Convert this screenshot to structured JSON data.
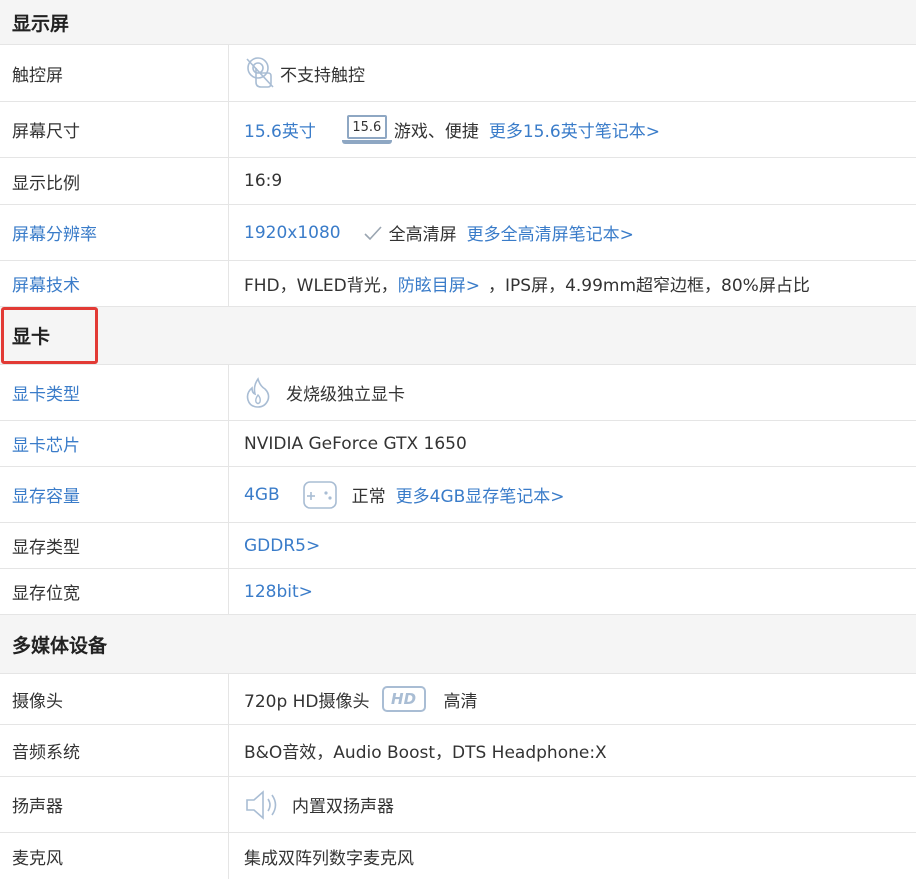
{
  "sections": {
    "display": {
      "title": "显示屏",
      "touch": {
        "label": "触控屏",
        "value": "不支持触控"
      },
      "size": {
        "label": "屏幕尺寸",
        "value": "15.6英寸",
        "badge": "15.6",
        "tag": "游戏、便捷",
        "more": "更多15.6英寸笔记本>"
      },
      "ratio": {
        "label": "显示比例",
        "value": "16:9"
      },
      "resolution": {
        "label": "屏幕分辨率",
        "value": "1920x1080",
        "tag": "全高清屏",
        "more": "更多全高清屏笔记本>"
      },
      "tech": {
        "label": "屏幕技术",
        "prefix": "FHD，WLED背光，",
        "link": "防眩目屏>",
        "suffix": "，IPS屏，4.99mm超窄边框，80%屏占比"
      }
    },
    "gpu": {
      "title": "显卡",
      "type": {
        "label": "显卡类型",
        "value": "发烧级独立显卡"
      },
      "chip": {
        "label": "显卡芯片",
        "value": "NVIDIA GeForce GTX 1650"
      },
      "memory": {
        "label": "显存容量",
        "value": "4GB",
        "tag": "正常",
        "more": "更多4GB显存笔记本>"
      },
      "memtype": {
        "label": "显存类型",
        "value": "GDDR5>"
      },
      "width": {
        "label": "显存位宽",
        "value": "128bit>"
      }
    },
    "media": {
      "title": "多媒体设备",
      "camera": {
        "label": "摄像头",
        "value": "720p HD摄像头",
        "badge": "HD",
        "tag": "高清"
      },
      "audio": {
        "label": "音频系统",
        "value": "B&O音效，Audio Boost，DTS Headphone:X"
      },
      "speaker": {
        "label": "扬声器",
        "value": "内置双扬声器"
      },
      "mic": {
        "label": "麦克风",
        "value": "集成双阵列数字麦克风"
      }
    }
  },
  "colors": {
    "link": "#3a7cc9",
    "highlight": "#e23a35",
    "icon": "#8ea7c3"
  }
}
